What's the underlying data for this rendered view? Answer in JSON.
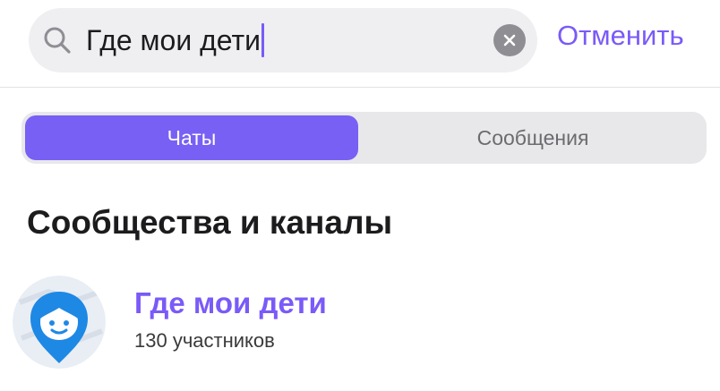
{
  "search": {
    "query": "Где мои дети",
    "cancel_label": "Отменить"
  },
  "tabs": [
    {
      "label": "Чаты",
      "active": true
    },
    {
      "label": "Сообщения",
      "active": false
    }
  ],
  "section": {
    "title": "Сообщества и каналы"
  },
  "results": [
    {
      "title": "Где мои дети",
      "subtitle": "130 участников",
      "avatar_icon": "child-face-location-pin-icon"
    }
  ],
  "colors": {
    "accent": "#7a5af8",
    "segment_active": "#7860f5",
    "avatar_blue": "#1e88e5"
  }
}
